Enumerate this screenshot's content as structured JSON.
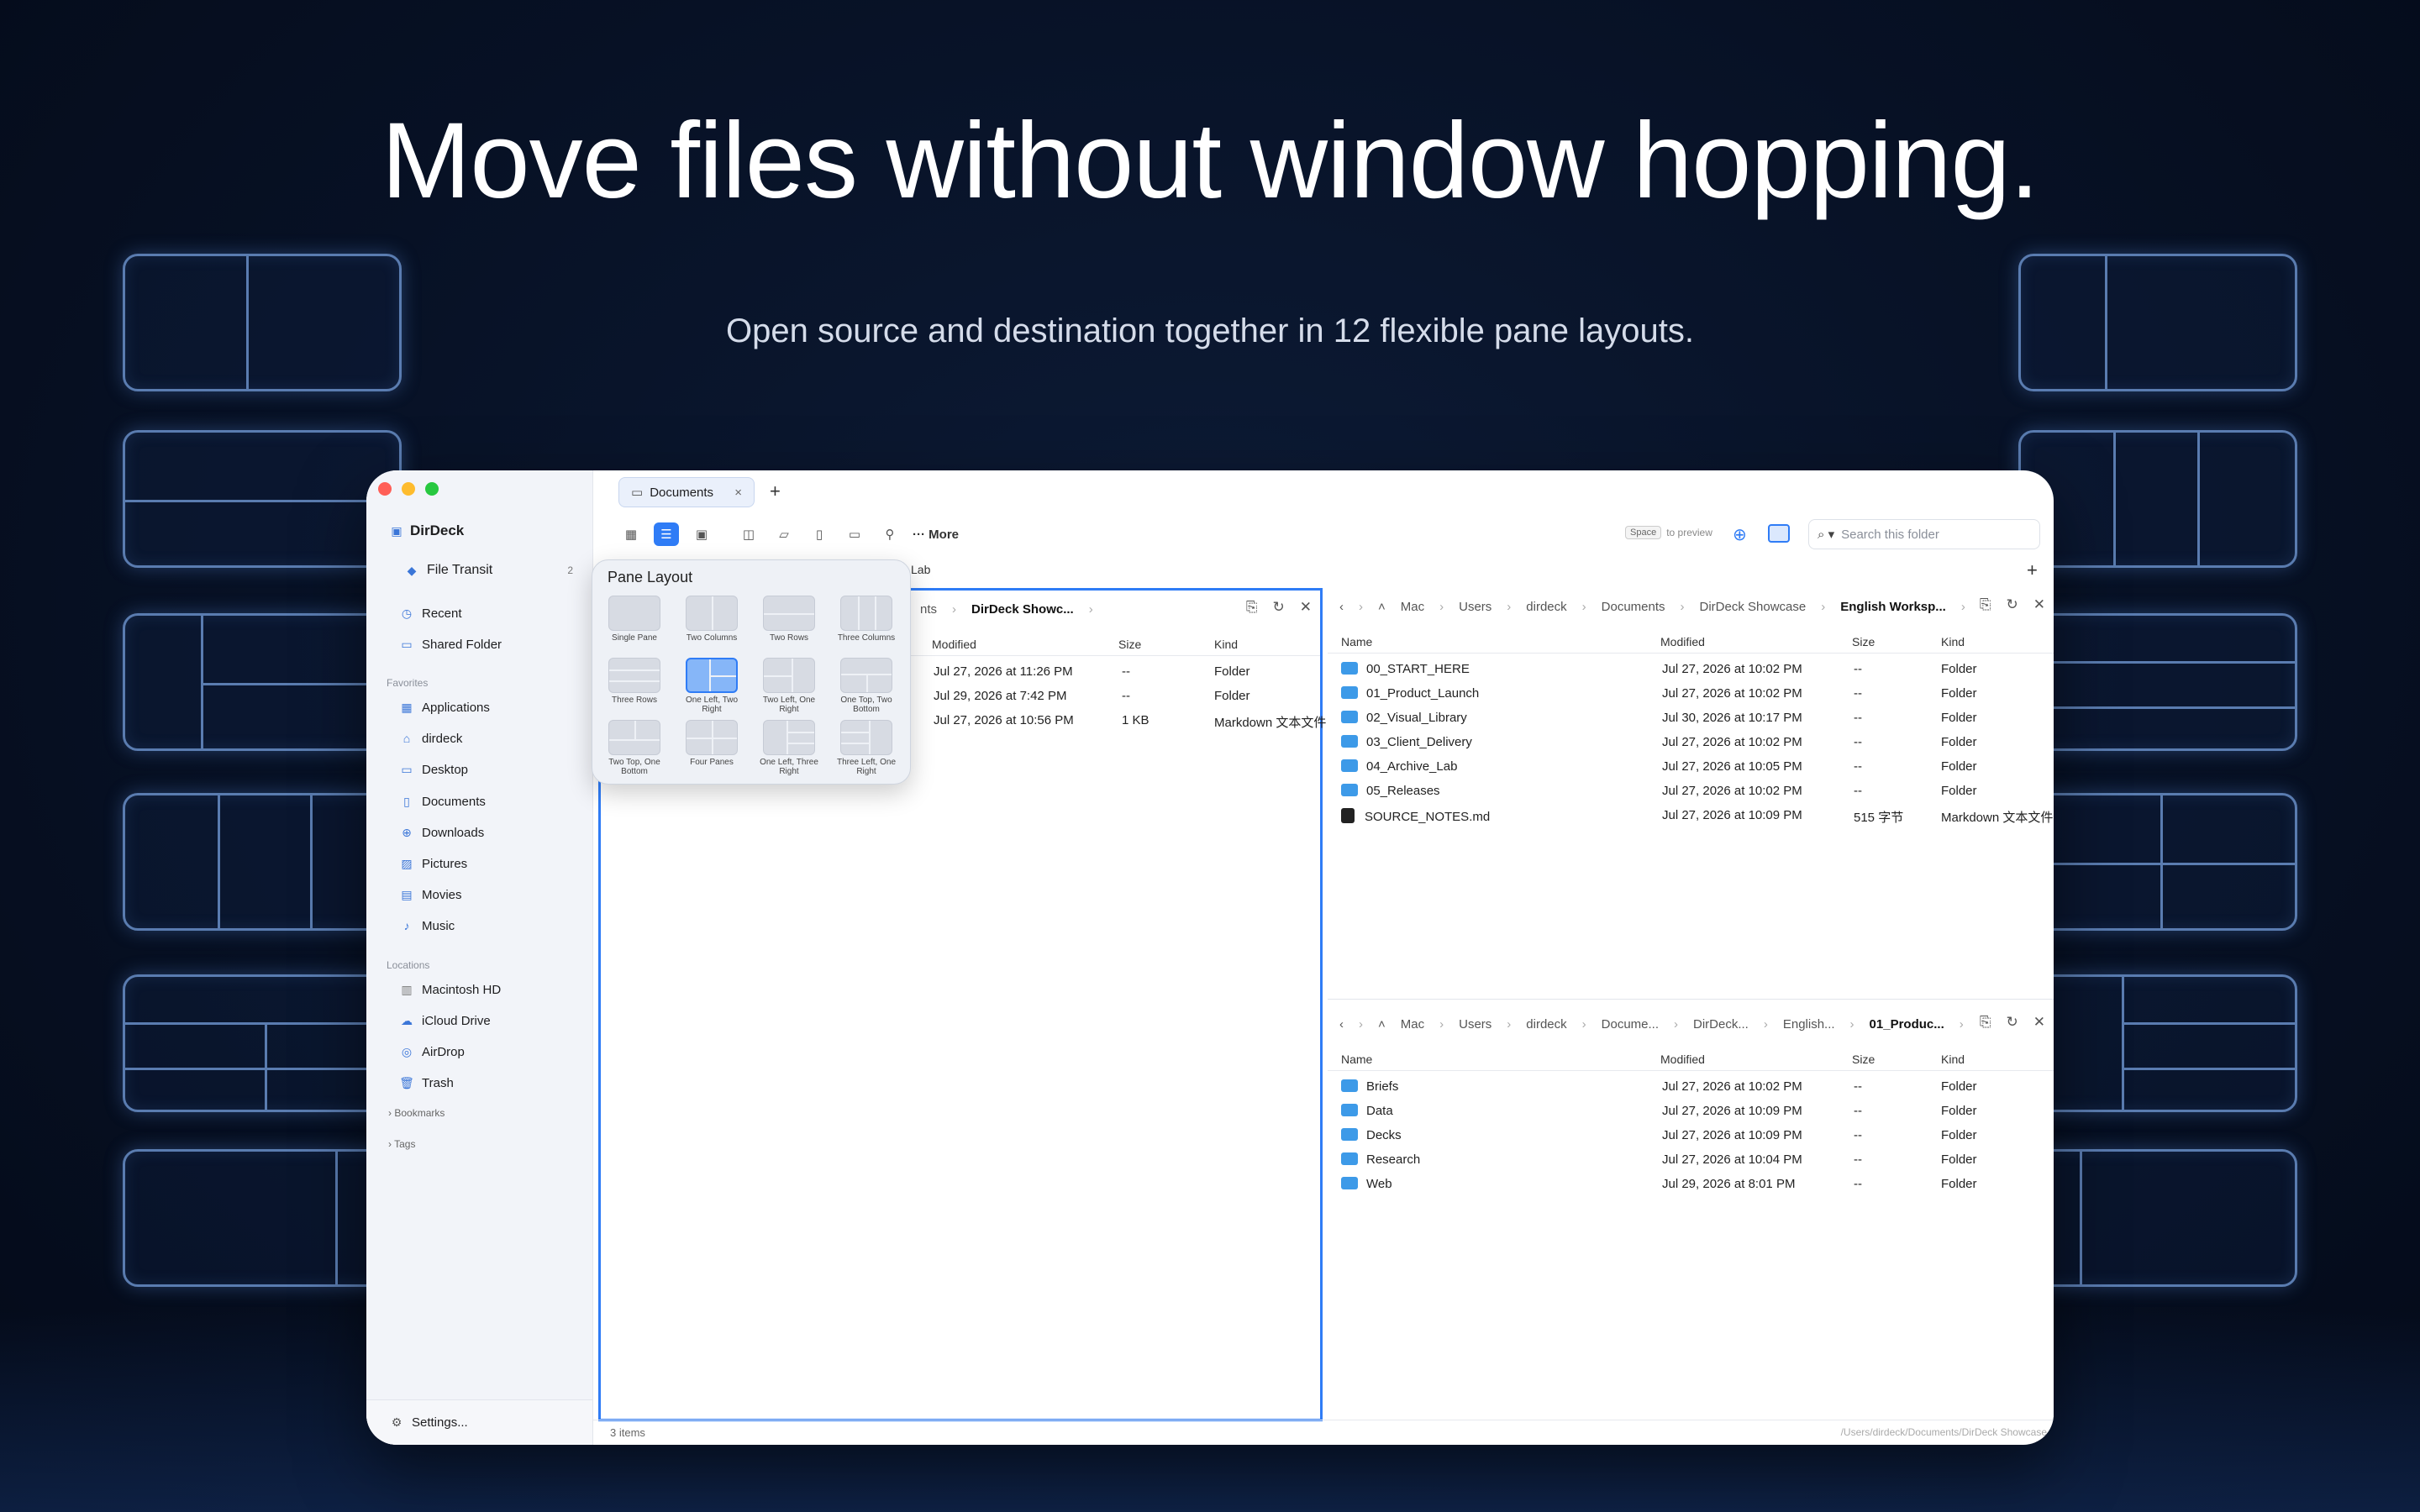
{
  "headline": "Move files without window hopping.",
  "subline": "Open source and destination together in 12 flexible pane layouts.",
  "sidebar": {
    "app_name": "DirDeck",
    "file_transit": {
      "label": "File Transit",
      "count": "2"
    },
    "top_items": [
      {
        "label": "Recent"
      },
      {
        "label": "Shared Folder"
      }
    ],
    "favorites_heading": "Favorites",
    "favorites": [
      {
        "label": "Applications"
      },
      {
        "label": "dirdeck"
      },
      {
        "label": "Desktop"
      },
      {
        "label": "Documents"
      },
      {
        "label": "Downloads"
      },
      {
        "label": "Pictures"
      },
      {
        "label": "Movies"
      },
      {
        "label": "Music"
      }
    ],
    "locations_heading": "Locations",
    "locations": [
      {
        "label": "Macintosh HD"
      },
      {
        "label": "iCloud Drive"
      },
      {
        "label": "AirDrop"
      },
      {
        "label": "Trash"
      }
    ],
    "bookmarks": "Bookmarks",
    "tags": "Tags",
    "settings": "Settings..."
  },
  "tab": {
    "label": "Documents"
  },
  "toolbar": {
    "more": "More",
    "space_key": "Space",
    "space_hint": "to preview",
    "search_placeholder": "Search this folder"
  },
  "popover": {
    "title": "Pane Layout",
    "layouts": [
      {
        "label": "Single Pane"
      },
      {
        "label": "Two Columns"
      },
      {
        "label": "Two Rows"
      },
      {
        "label": "Three Columns"
      },
      {
        "label": "Three Rows"
      },
      {
        "label": "One Left, Two Right"
      },
      {
        "label": "Two Left, One Right"
      },
      {
        "label": "One Top, Two Bottom"
      },
      {
        "label": "Two Top, One Bottom"
      },
      {
        "label": "Four Panes"
      },
      {
        "label": "One Left, Three Right"
      },
      {
        "label": "Three Left, One Right"
      }
    ]
  },
  "left_pane": {
    "crumb_partial": "nts",
    "crumb_current": "DirDeck Showc...",
    "crumb_peek": "Lab",
    "columns": {
      "modified": "Modified",
      "size": "Size",
      "kind": "Kind"
    },
    "rows": [
      {
        "modified": "Jul 27, 2026 at 11:26 PM",
        "size": "--",
        "kind": "Folder"
      },
      {
        "modified": "Jul 29, 2026 at 7:42 PM",
        "size": "--",
        "kind": "Folder"
      },
      {
        "modified": "Jul 27, 2026 at 10:56 PM",
        "size": "1 KB",
        "kind": "Markdown 文本文件"
      }
    ]
  },
  "right_top_pane": {
    "crumbs": [
      "Mac",
      "Users",
      "dirdeck",
      "Documents",
      "DirDeck Showcase"
    ],
    "crumb_current": "English Worksp...",
    "columns": {
      "name": "Name",
      "modified": "Modified",
      "size": "Size",
      "kind": "Kind"
    },
    "rows": [
      {
        "name": "00_START_HERE",
        "modified": "Jul 27, 2026 at 10:02 PM",
        "size": "--",
        "kind": "Folder",
        "type": "folder"
      },
      {
        "name": "01_Product_Launch",
        "modified": "Jul 27, 2026 at 10:02 PM",
        "size": "--",
        "kind": "Folder",
        "type": "folder"
      },
      {
        "name": "02_Visual_Library",
        "modified": "Jul 30, 2026 at 10:17 PM",
        "size": "--",
        "kind": "Folder",
        "type": "folder"
      },
      {
        "name": "03_Client_Delivery",
        "modified": "Jul 27, 2026 at 10:02 PM",
        "size": "--",
        "kind": "Folder",
        "type": "folder"
      },
      {
        "name": "04_Archive_Lab",
        "modified": "Jul 27, 2026 at 10:05 PM",
        "size": "--",
        "kind": "Folder",
        "type": "folder"
      },
      {
        "name": "05_Releases",
        "modified": "Jul 27, 2026 at 10:02 PM",
        "size": "--",
        "kind": "Folder",
        "type": "folder"
      },
      {
        "name": "SOURCE_NOTES.md",
        "modified": "Jul 27, 2026 at 10:09 PM",
        "size": "515 字节",
        "kind": "Markdown 文本文件",
        "type": "md"
      }
    ]
  },
  "right_bottom_pane": {
    "crumbs": [
      "Mac",
      "Users",
      "dirdeck",
      "Docume...",
      "DirDeck...",
      "English..."
    ],
    "crumb_current": "01_Produc...",
    "columns": {
      "name": "Name",
      "modified": "Modified",
      "size": "Size",
      "kind": "Kind"
    },
    "rows": [
      {
        "name": "Briefs",
        "modified": "Jul 27, 2026 at 10:02 PM",
        "size": "--",
        "kind": "Folder"
      },
      {
        "name": "Data",
        "modified": "Jul 27, 2026 at 10:09 PM",
        "size": "--",
        "kind": "Folder"
      },
      {
        "name": "Decks",
        "modified": "Jul 27, 2026 at 10:09 PM",
        "size": "--",
        "kind": "Folder"
      },
      {
        "name": "Research",
        "modified": "Jul 27, 2026 at 10:04 PM",
        "size": "--",
        "kind": "Folder"
      },
      {
        "name": "Web",
        "modified": "Jul 29, 2026 at 8:01 PM",
        "size": "--",
        "kind": "Folder"
      }
    ]
  },
  "status": {
    "items": "3 items",
    "path": "/Users/dirdeck/Documents/DirDeck Showcase"
  },
  "colors": {
    "accent": "#2f7cf6",
    "folder": "#3d9ae8",
    "glow": "#5a7cb0"
  }
}
